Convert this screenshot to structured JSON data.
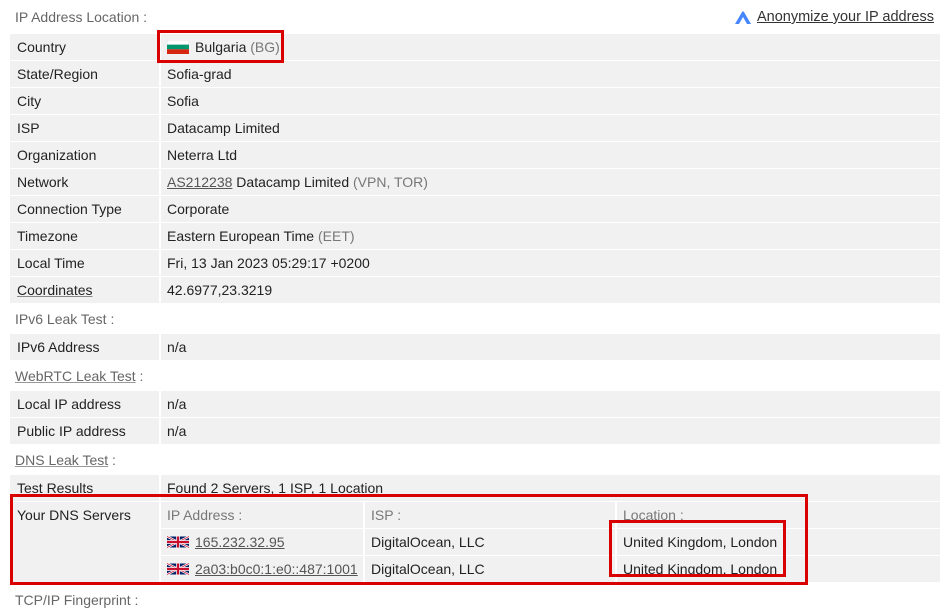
{
  "header": {
    "location_title": "IP Address Location :",
    "anonymize_link": "Anonymize your IP address"
  },
  "location": {
    "rows": [
      {
        "label": "Country",
        "value": "Bulgaria",
        "extra": "(BG)"
      },
      {
        "label": "State/Region",
        "value": "Sofia-grad"
      },
      {
        "label": "City",
        "value": "Sofia"
      },
      {
        "label": "ISP",
        "value": "Datacamp Limited"
      },
      {
        "label": "Organization",
        "value": "Neterra Ltd"
      },
      {
        "label": "Network",
        "link": "AS212238",
        "value": "Datacamp Limited",
        "extra": "(VPN, TOR)"
      },
      {
        "label": "Connection Type",
        "value": "Corporate"
      },
      {
        "label": "Timezone",
        "value": "Eastern European Time",
        "extra": "(EET)"
      },
      {
        "label": "Local Time",
        "value": "Fri, 13 Jan 2023 05:29:17 +0200"
      },
      {
        "label": "Coordinates",
        "value": "42.6977,23.3219"
      }
    ]
  },
  "ipv6": {
    "title": "IPv6 Leak Test :",
    "address_label": "IPv6 Address",
    "address_value": "n/a"
  },
  "webrtc": {
    "title_link": "WebRTC Leak Test",
    "title_suffix": " :",
    "local_label": "Local IP address",
    "local_value": "n/a",
    "public_label": "Public IP address",
    "public_value": "n/a"
  },
  "dns": {
    "title_link": "DNS Leak Test",
    "title_suffix": " :",
    "results_label": "Test Results",
    "results_value": "Found 2 Servers, 1 ISP, 1 Location",
    "servers_label": "Your DNS Servers",
    "columns": [
      "IP Address :",
      "ISP :",
      "Location :"
    ],
    "servers": [
      {
        "ip": "165.232.32.95",
        "isp": "DigitalOcean, LLC",
        "location": "United Kingdom, London"
      },
      {
        "ip": "2a03:b0c0:1:e0::487:1001",
        "isp": "DigitalOcean, LLC",
        "location": "United Kingdom, London"
      }
    ]
  },
  "footer": {
    "partial_title": "TCP/IP Fingerprint :"
  },
  "colors": {
    "highlight_box": "#d90000",
    "row_bg": "#f1f1f1",
    "anonymize_icon": "#4687ff"
  }
}
